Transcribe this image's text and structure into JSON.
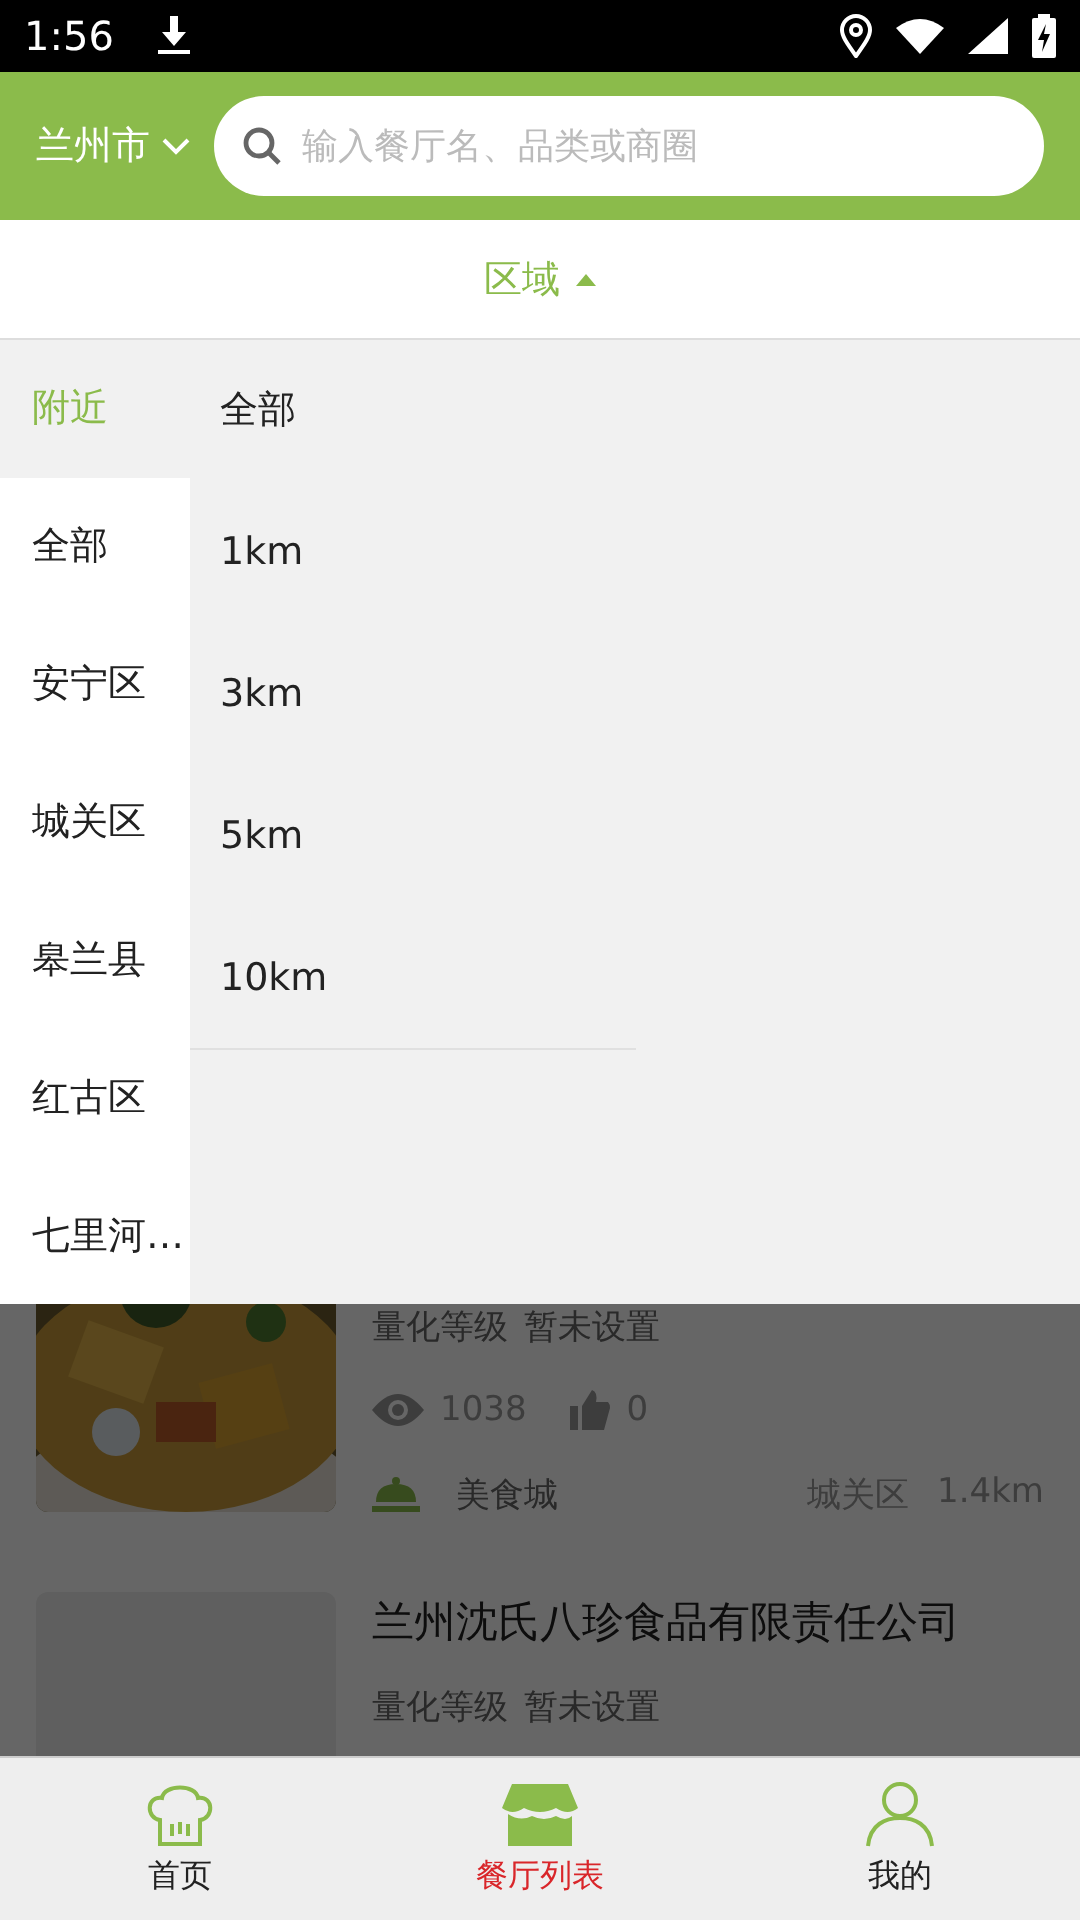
{
  "status_bar": {
    "time": "1:56"
  },
  "header": {
    "city": "兰州市",
    "search": {
      "placeholder": "输入餐厅名、品类或商圈"
    }
  },
  "filter": {
    "label": "区域",
    "expanded": true
  },
  "districts": [
    {
      "label": "附近",
      "selected": true
    },
    {
      "label": "全部",
      "selected": false
    },
    {
      "label": "安宁区",
      "selected": false
    },
    {
      "label": "城关区",
      "selected": false
    },
    {
      "label": "皋兰县",
      "selected": false
    },
    {
      "label": "红古区",
      "selected": false
    },
    {
      "label": "七里河…",
      "selected": false
    }
  ],
  "distances": [
    {
      "label": "全部"
    },
    {
      "label": "1km"
    },
    {
      "label": "3km"
    },
    {
      "label": "5km"
    },
    {
      "label": "10km"
    }
  ],
  "restaurants": [
    {
      "rating": "量化等级",
      "rating_value": "暂未设置",
      "views": "1038",
      "likes": "0",
      "category": "美食城",
      "district": "城关区",
      "distance": "1.4km"
    },
    {
      "kind": "placeholder",
      "title": "兰州沈氏八珍食品有限责任公司",
      "rating": "量化等级",
      "rating_value": "暂未设置"
    }
  ],
  "tabs": [
    {
      "kind": "home",
      "label": "首页",
      "selected": false
    },
    {
      "kind": "list",
      "label": "餐厅列表",
      "selected": true
    },
    {
      "kind": "me",
      "label": "我的",
      "selected": false
    }
  ]
}
